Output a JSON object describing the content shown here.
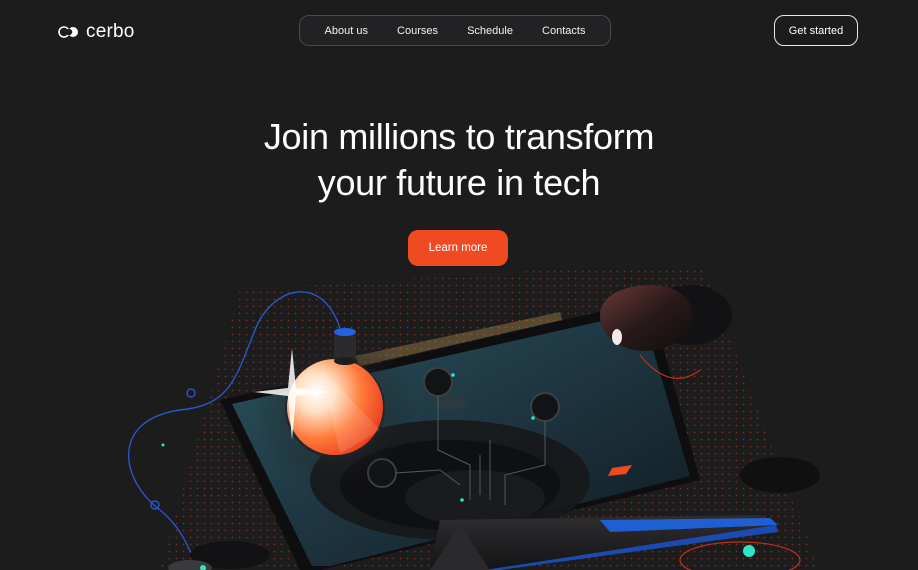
{
  "brand": {
    "name": "cerbo",
    "logo_icon": "interlocking-circles-icon"
  },
  "nav": {
    "items": [
      {
        "label": "About us"
      },
      {
        "label": "Courses"
      },
      {
        "label": "Schedule"
      },
      {
        "label": "Contacts"
      }
    ]
  },
  "header": {
    "cta_label": "Get started"
  },
  "hero": {
    "title_line1": "Join millions to transform",
    "title_line2": "your future in tech",
    "button_label": "Learn more",
    "illustration": "laptop-with-glowing-orb-illustration"
  },
  "colors": {
    "background": "#1c1c1d",
    "accent": "#f04a23",
    "text": "#ffffff",
    "glow_cyan": "#2ee6c4",
    "laptop_blue": "#1f5fd1"
  }
}
